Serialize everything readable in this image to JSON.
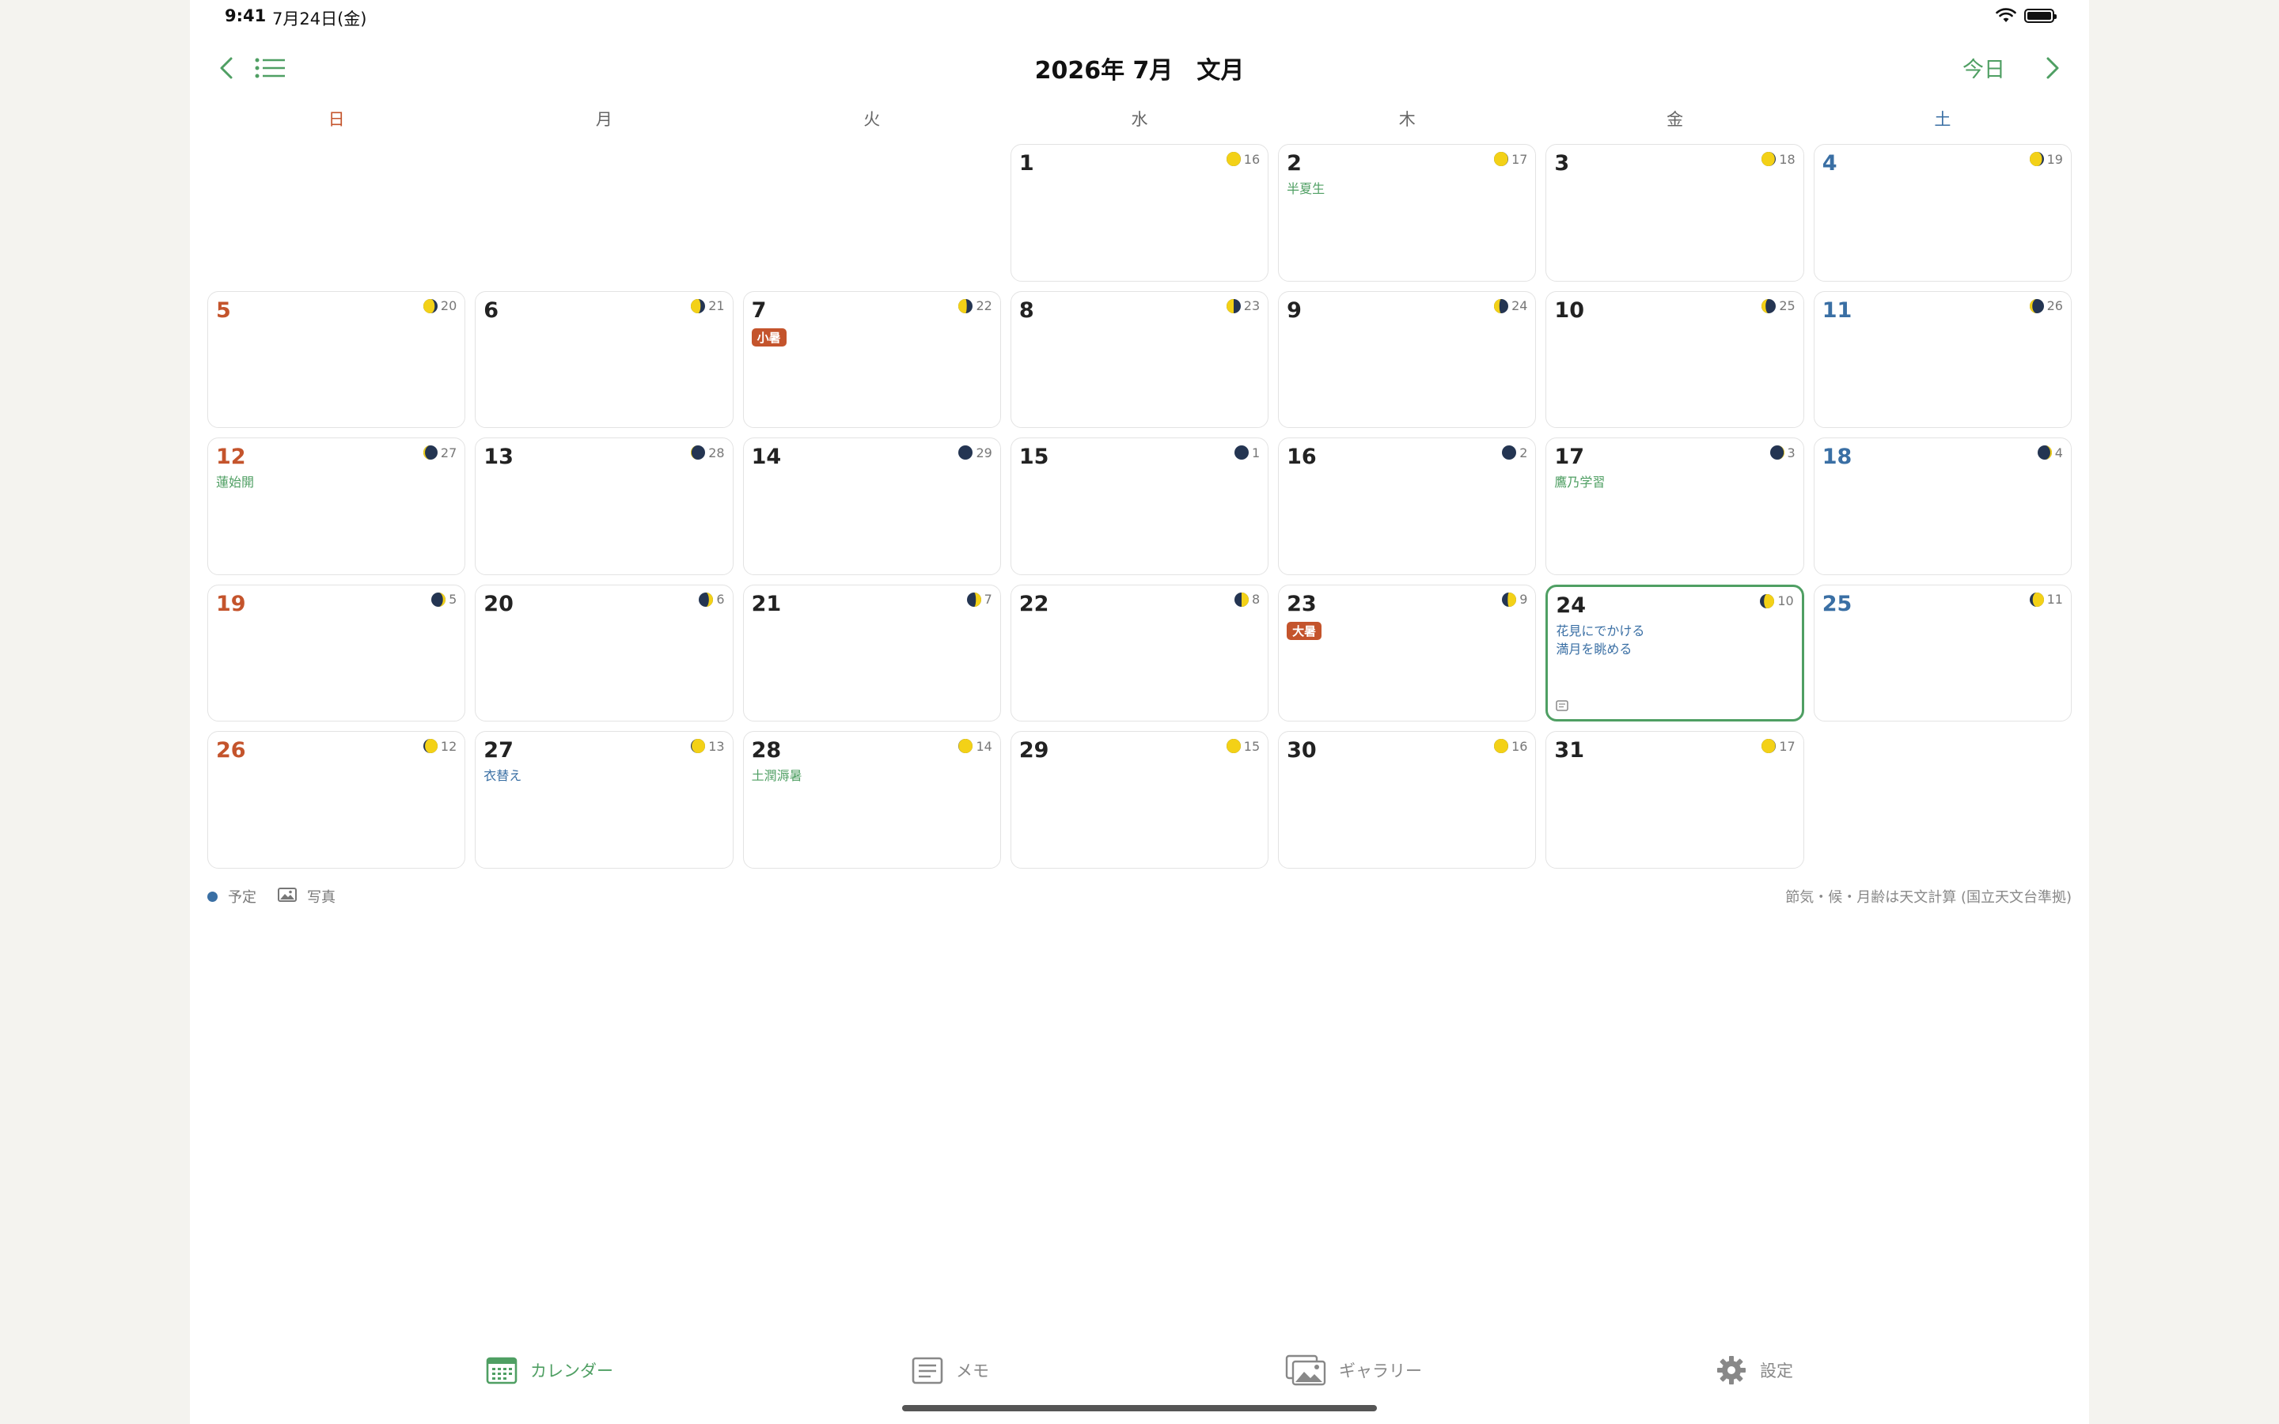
{
  "status": {
    "time": "9:41",
    "date": "7月24日(金)"
  },
  "header": {
    "title": "2026年 7月　文月",
    "today_label": "今日"
  },
  "colors": {
    "accent": "#4f9f63",
    "sunday": "#c4542c",
    "saturday": "#3a6fa4",
    "today_border": "#4f9f63"
  },
  "weekdays": [
    "日",
    "月",
    "火",
    "水",
    "木",
    "金",
    "土"
  ],
  "days": [
    {
      "num": "1",
      "age": "16",
      "phase": 0.52
    },
    {
      "num": "2",
      "age": "17",
      "phase": 0.55,
      "notes": [
        {
          "text": "半夏生",
          "color": "green"
        }
      ]
    },
    {
      "num": "3",
      "age": "18",
      "phase": 0.58
    },
    {
      "num": "4",
      "age": "19",
      "phase": 0.62
    },
    {
      "num": "5",
      "age": "20",
      "phase": 0.65
    },
    {
      "num": "6",
      "age": "21",
      "phase": 0.69
    },
    {
      "num": "7",
      "age": "22",
      "phase": 0.72,
      "badge": "小暑"
    },
    {
      "num": "8",
      "age": "23",
      "phase": 0.75
    },
    {
      "num": "9",
      "age": "24",
      "phase": 0.79
    },
    {
      "num": "10",
      "age": "25",
      "phase": 0.82
    },
    {
      "num": "11",
      "age": "26",
      "phase": 0.86
    },
    {
      "num": "12",
      "age": "27",
      "phase": 0.89,
      "notes": [
        {
          "text": "蓮始開",
          "color": "green"
        }
      ]
    },
    {
      "num": "13",
      "age": "28",
      "phase": 0.93
    },
    {
      "num": "14",
      "age": "29",
      "phase": 0.96
    },
    {
      "num": "15",
      "age": "1",
      "phase": 0.0
    },
    {
      "num": "16",
      "age": "2",
      "phase": 0.04
    },
    {
      "num": "17",
      "age": "3",
      "phase": 0.07,
      "notes": [
        {
          "text": "鷹乃学習",
          "color": "green"
        }
      ]
    },
    {
      "num": "18",
      "age": "4",
      "phase": 0.11
    },
    {
      "num": "19",
      "age": "5",
      "phase": 0.14
    },
    {
      "num": "20",
      "age": "6",
      "phase": 0.18
    },
    {
      "num": "21",
      "age": "7",
      "phase": 0.21
    },
    {
      "num": "22",
      "age": "8",
      "phase": 0.25
    },
    {
      "num": "23",
      "age": "9",
      "phase": 0.28,
      "badge": "大暑"
    },
    {
      "num": "24",
      "age": "10",
      "phase": 0.32,
      "today": true,
      "notes": [
        {
          "text": "花見にでかける",
          "color": "blue"
        },
        {
          "text": "満月を眺める",
          "color": "blue"
        }
      ]
    },
    {
      "num": "25",
      "age": "11",
      "phase": 0.35
    },
    {
      "num": "26",
      "age": "12",
      "phase": 0.39
    },
    {
      "num": "27",
      "age": "13",
      "phase": 0.42,
      "notes": [
        {
          "text": "衣替え",
          "color": "blue"
        }
      ]
    },
    {
      "num": "28",
      "age": "14",
      "phase": 0.46,
      "notes": [
        {
          "text": "土潤溽暑",
          "color": "green"
        }
      ]
    },
    {
      "num": "29",
      "age": "15",
      "phase": 0.49
    },
    {
      "num": "30",
      "age": "16",
      "phase": 0.52
    },
    {
      "num": "31",
      "age": "17",
      "phase": 0.55
    }
  ],
  "first_weekday": 3,
  "legend": {
    "plan": "予定",
    "photo": "写真",
    "footnote": "節気・候・月齢は天文計算 (国立天文台準拠)"
  },
  "tabs": [
    {
      "label": "カレンダー",
      "icon": "calendar-icon"
    },
    {
      "label": "メモ",
      "icon": "memo-icon"
    },
    {
      "label": "ギャラリー",
      "icon": "gallery-icon"
    },
    {
      "label": "設定",
      "icon": "gear-icon"
    }
  ]
}
